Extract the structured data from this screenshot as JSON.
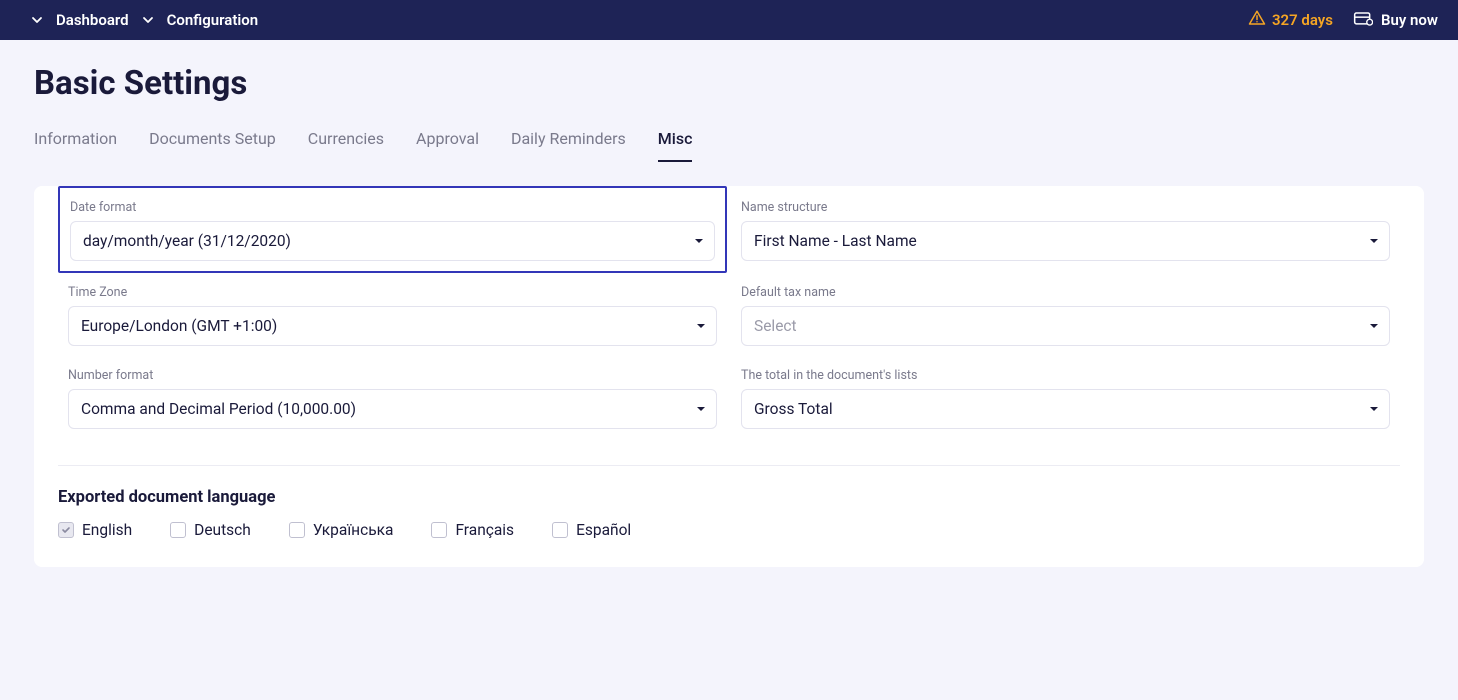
{
  "topbar": {
    "breadcrumbs": [
      "Dashboard",
      "Configuration"
    ],
    "days_count": "327 days",
    "buy_now": "Buy now"
  },
  "page_title": "Basic Settings",
  "tabs": [
    {
      "label": "Information",
      "active": false
    },
    {
      "label": "Documents Setup",
      "active": false
    },
    {
      "label": "Currencies",
      "active": false
    },
    {
      "label": "Approval",
      "active": false
    },
    {
      "label": "Daily Reminders",
      "active": false
    },
    {
      "label": "Misc",
      "active": true
    }
  ],
  "fields": {
    "date_format": {
      "label": "Date format",
      "value": "day/month/year (31/12/2020)"
    },
    "name_structure": {
      "label": "Name structure",
      "value": "First Name - Last Name"
    },
    "time_zone": {
      "label": "Time Zone",
      "value": "Europe/London (GMT +1:00)"
    },
    "default_tax": {
      "label": "Default tax name",
      "placeholder": "Select"
    },
    "number_format": {
      "label": "Number format",
      "value": "Comma and Decimal Period (10,000.00)"
    },
    "total_lists": {
      "label": "The total in the document's lists",
      "value": "Gross Total"
    }
  },
  "export_section": {
    "title": "Exported document language",
    "languages": [
      {
        "label": "English",
        "checked": true
      },
      {
        "label": "Deutsch",
        "checked": false
      },
      {
        "label": "Українська",
        "checked": false
      },
      {
        "label": "Français",
        "checked": false
      },
      {
        "label": "Español",
        "checked": false
      }
    ]
  }
}
